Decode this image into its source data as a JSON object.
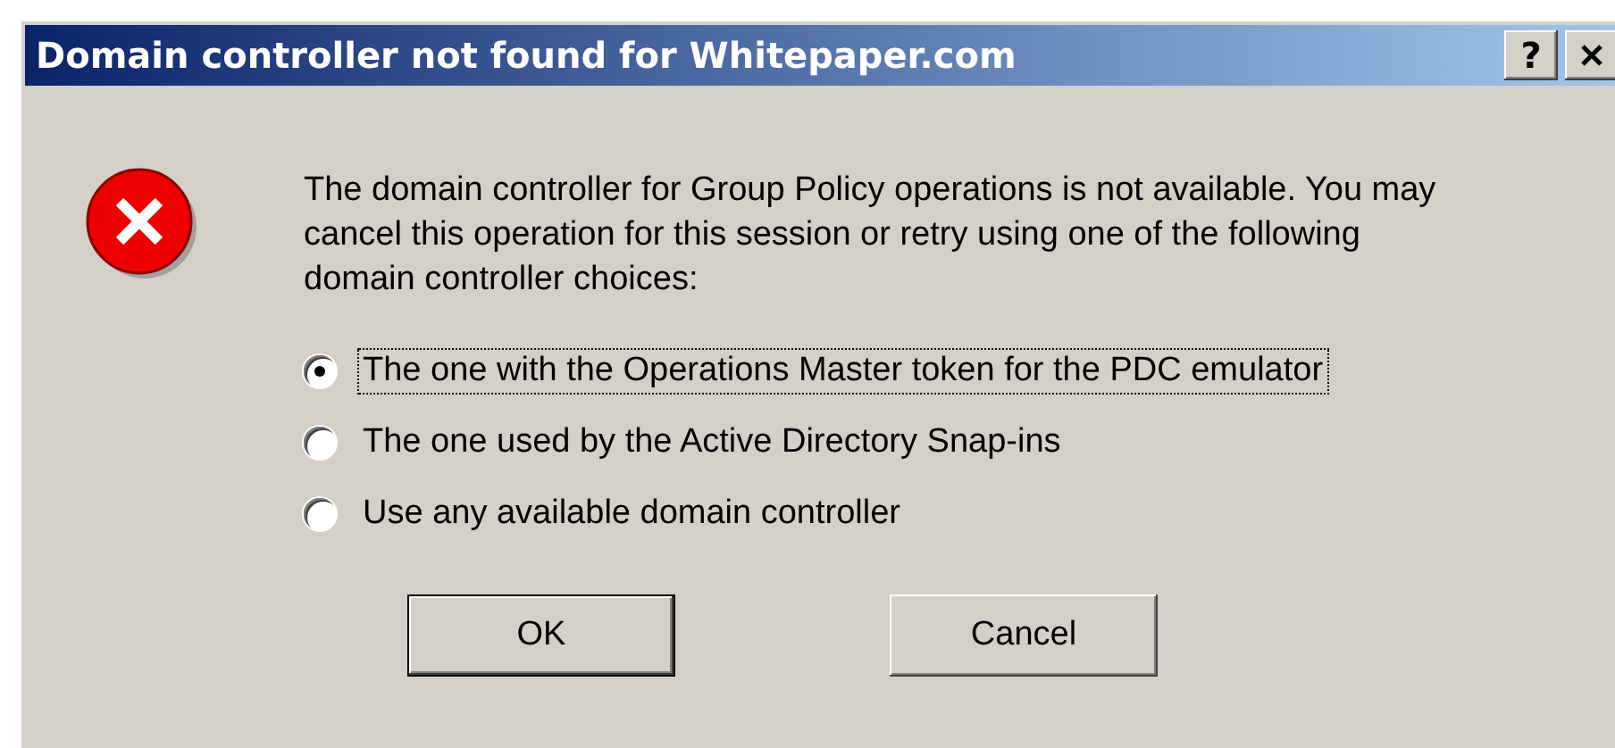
{
  "window": {
    "title": "Domain controller not found for Whitepaper.com",
    "help_button": "?"
  },
  "message": "The domain controller for Group Policy operations is not available.  You may cancel this operation for this session or retry using one of the following domain controller choices:",
  "options": [
    {
      "label": "The one with the Operations Master token for the PDC emulator",
      "selected": true
    },
    {
      "label": "The one used by the Active Directory Snap-ins",
      "selected": false
    },
    {
      "label": "Use any available domain controller",
      "selected": false
    }
  ],
  "buttons": [
    {
      "label": "OK",
      "default": true
    },
    {
      "label": "Cancel",
      "default": false
    }
  ]
}
